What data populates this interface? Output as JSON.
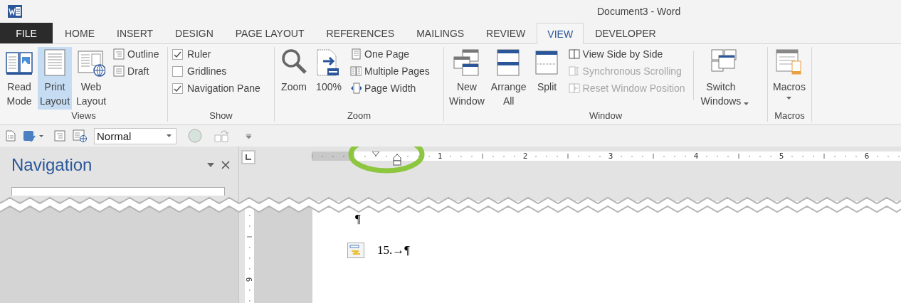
{
  "window": {
    "title": "Document3 - Word"
  },
  "tabs": [
    {
      "label": "FILE",
      "kind": "file",
      "selected": false
    },
    {
      "label": "HOME",
      "kind": "tab",
      "selected": false
    },
    {
      "label": "INSERT",
      "kind": "tab",
      "selected": false
    },
    {
      "label": "DESIGN",
      "kind": "tab",
      "selected": false
    },
    {
      "label": "PAGE LAYOUT",
      "kind": "tab",
      "selected": false
    },
    {
      "label": "REFERENCES",
      "kind": "tab",
      "selected": false
    },
    {
      "label": "MAILINGS",
      "kind": "tab",
      "selected": false
    },
    {
      "label": "REVIEW",
      "kind": "tab",
      "selected": false
    },
    {
      "label": "VIEW",
      "kind": "tab",
      "selected": true
    },
    {
      "label": "DEVELOPER",
      "kind": "tab",
      "selected": false
    }
  ],
  "ribbon": {
    "groups": [
      {
        "label": "Views",
        "items": [
          {
            "kind": "large",
            "label": "Read Mode",
            "selected": false
          },
          {
            "kind": "large",
            "label": "Print Layout",
            "selected": true
          },
          {
            "kind": "large",
            "label": "Web Layout",
            "selected": false
          },
          {
            "kind": "small",
            "label": "Outline"
          },
          {
            "kind": "small",
            "label": "Draft"
          }
        ]
      },
      {
        "label": "Show",
        "items": [
          {
            "kind": "check",
            "label": "Ruler",
            "checked": true
          },
          {
            "kind": "check",
            "label": "Gridlines",
            "checked": false
          },
          {
            "kind": "check",
            "label": "Navigation Pane",
            "checked": true
          }
        ]
      },
      {
        "label": "Zoom",
        "items": [
          {
            "kind": "large",
            "label": "Zoom"
          },
          {
            "kind": "large",
            "label": "100%"
          },
          {
            "kind": "small",
            "label": "One Page"
          },
          {
            "kind": "small",
            "label": "Multiple Pages"
          },
          {
            "kind": "small",
            "label": "Page Width"
          }
        ]
      },
      {
        "label": "Window",
        "items": [
          {
            "kind": "large",
            "label": "New Window"
          },
          {
            "kind": "large",
            "label": "Arrange All"
          },
          {
            "kind": "large",
            "label": "Split"
          },
          {
            "kind": "small",
            "label": "View Side by Side",
            "disabled": false
          },
          {
            "kind": "small",
            "label": "Synchronous Scrolling",
            "disabled": true
          },
          {
            "kind": "small",
            "label": "Reset Window Position",
            "disabled": true
          },
          {
            "kind": "large",
            "label": "Switch Windows",
            "dropdown": true
          }
        ]
      },
      {
        "label": "Macros",
        "items": [
          {
            "kind": "large",
            "label": "Macros",
            "dropdown": true
          }
        ]
      }
    ]
  },
  "quick_access": {
    "style_box": {
      "value": "Normal"
    }
  },
  "navigation": {
    "title": "Navigation"
  },
  "ruler": {
    "numbers": [
      "1",
      "2",
      "3",
      "4",
      "5",
      "6"
    ]
  },
  "vertical_ruler": {
    "numbers": [
      "9"
    ]
  },
  "document": {
    "lines": [
      {
        "text": "¶",
        "smart_tag": false
      },
      {
        "text": "15.→¶",
        "smart_tag": true
      }
    ]
  }
}
